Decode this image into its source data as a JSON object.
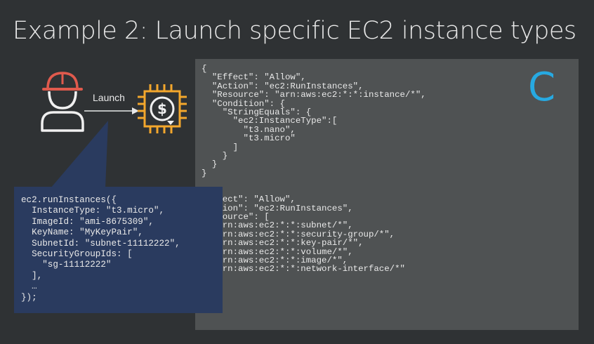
{
  "slide": {
    "title": "Example 2: Launch specific EC2 instance types"
  },
  "diagram": {
    "launch_label": "Launch",
    "user_icon": "user-with-hardhat-icon",
    "instance_icon": "ec2-instance-dollar-icon",
    "arrow_icon": "arrow-right-icon"
  },
  "policy": {
    "marker_letter": "C",
    "code": "{\n  \"Effect\": \"Allow\",\n  \"Action\": \"ec2:RunInstances\",\n  \"Resource\": \"arn:aws:ec2:*:*:instance/*\",\n  \"Condition\": {\n    \"StringEquals\": {\n      \"ec2:InstanceType\":[\n        \"t3.nano\",\n        \"t3.micro\"\n      ]\n    }\n  }\n}\n\n\n\"Effect\": \"Allow\",\n\"Action\": \"ec2:RunInstances\",\n\"Resource\": [\n  \"arn:aws:ec2:*:*:subnet/*\",\n  \"arn:aws:ec2:*:*:security-group/*\",\n  \"arn:aws:ec2:*:*:key-pair/*\",\n  \"arn:aws:ec2:*:*:volume/*\",\n  \"arn:aws:ec2:*:*:image/*\",\n  \"arn:aws:ec2:*:*:network-interface/*\"\n\n\n}"
  },
  "snippet": {
    "code": "ec2.runInstances({\n  InstanceType: \"t3.micro\",\n  ImageId: \"ami-8675309\",\n  KeyName: \"MyKeyPair\",\n  SubnetId: \"subnet-11112222\",\n  SecurityGroupIds: [\n    \"sg-11112222\"\n  ],\n  …\n});"
  },
  "colors": {
    "background": "#2f3234",
    "policy_panel": "#4f5253",
    "snippet_panel": "#2a3b5f",
    "accent_blue": "#27a9e1",
    "hardhat_red": "#e05a4d",
    "instance_orange": "#f3a72c"
  }
}
